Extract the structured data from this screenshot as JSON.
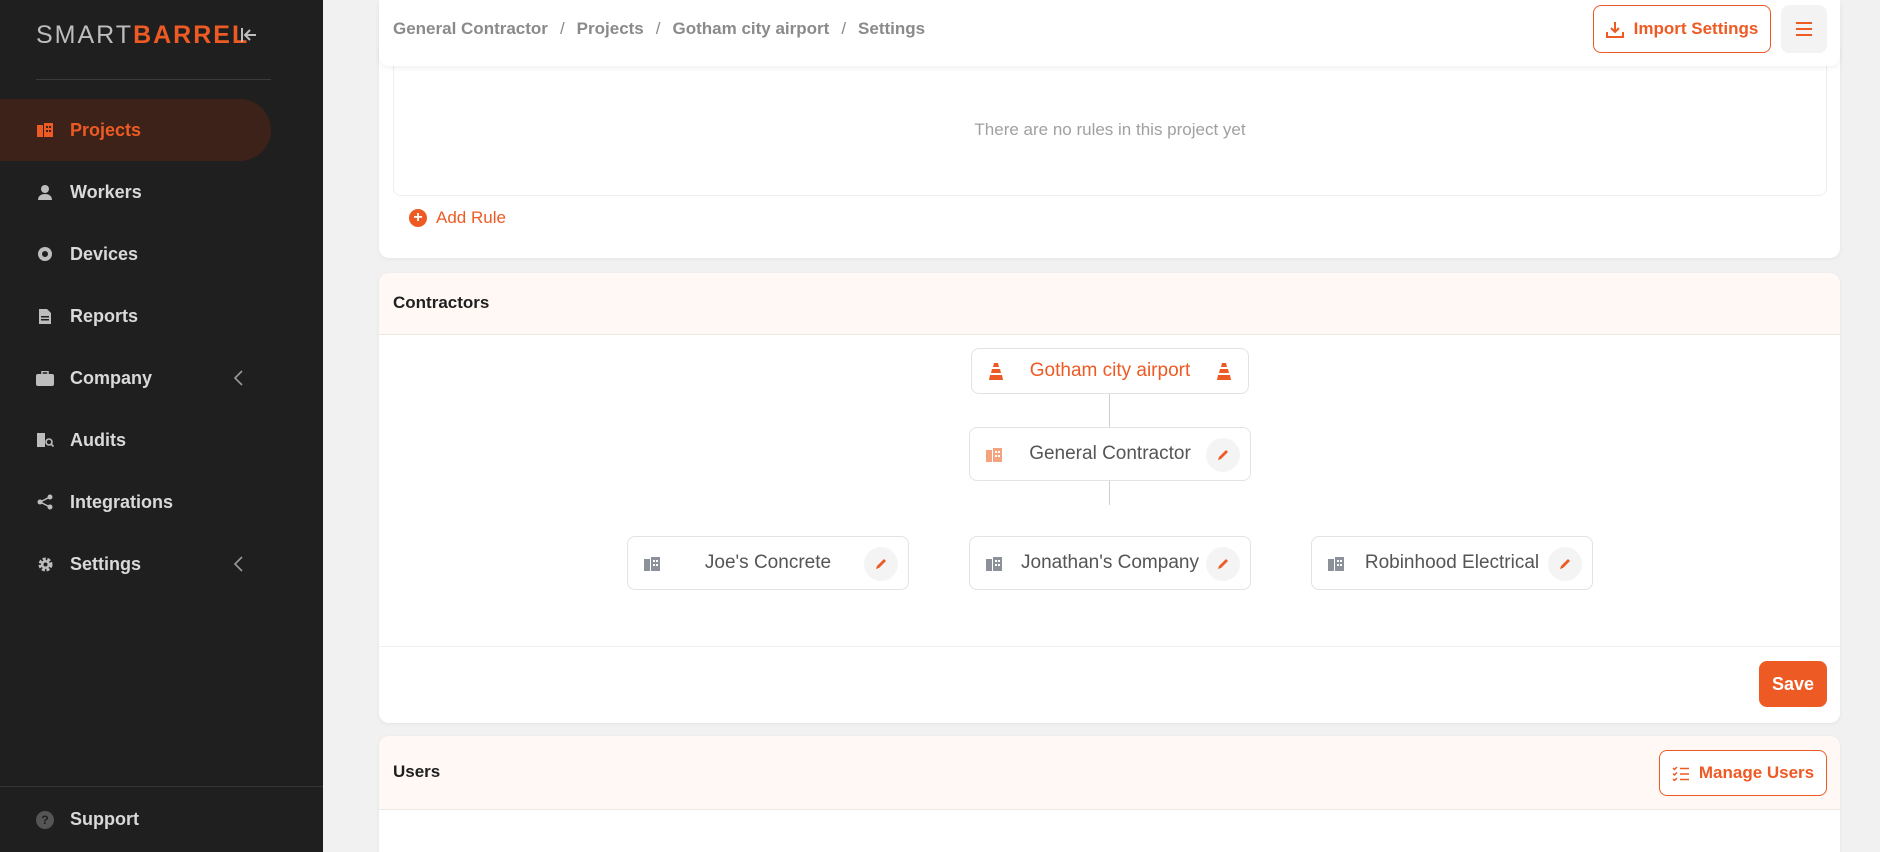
{
  "brand": {
    "part1": "SMART",
    "part2": "BARREL",
    "accent": "#ee5a24"
  },
  "sidebar": {
    "items": [
      {
        "label": "Projects",
        "icon": "building-icon",
        "active": true
      },
      {
        "label": "Workers",
        "icon": "worker-icon"
      },
      {
        "label": "Devices",
        "icon": "device-icon"
      },
      {
        "label": "Reports",
        "icon": "report-icon"
      },
      {
        "label": "Company",
        "icon": "briefcase-icon",
        "expandable": true
      },
      {
        "label": "Audits",
        "icon": "audit-icon"
      },
      {
        "label": "Integrations",
        "icon": "share-icon"
      },
      {
        "label": "Settings",
        "icon": "gear-icon",
        "expandable": true
      }
    ],
    "support": "Support"
  },
  "header": {
    "breadcrumb": [
      "General Contractor",
      "Projects",
      "Gotham city airport",
      "Settings"
    ],
    "separator": "/",
    "import_label": "Import Settings"
  },
  "rules": {
    "empty_text": "There are no rules in this project yet",
    "add_label": "Add Rule"
  },
  "contractors": {
    "title": "Contractors",
    "root": "Gotham city airport",
    "general": "General Contractor",
    "subs": [
      "Joe's Concrete",
      "Jonathan's Company",
      "Robinhood Electrical"
    ],
    "save_label": "Save"
  },
  "users": {
    "title": "Users",
    "manage_label": "Manage Users"
  }
}
